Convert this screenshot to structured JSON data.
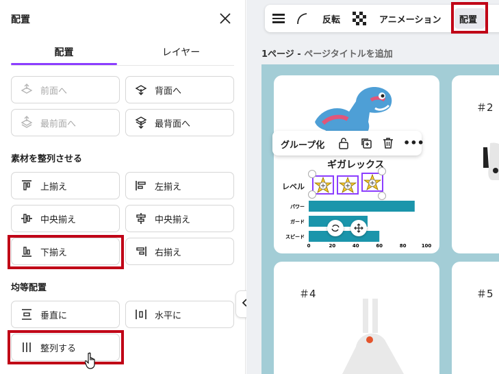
{
  "panel": {
    "title": "配置",
    "tabs": [
      "配置",
      "レイヤー"
    ],
    "order_buttons": [
      {
        "label": "前面へ",
        "icon": "bring-forward-icon",
        "disabled": true
      },
      {
        "label": "背面へ",
        "icon": "send-backward-icon",
        "disabled": false
      },
      {
        "label": "最前面へ",
        "icon": "bring-to-front-icon",
        "disabled": true
      },
      {
        "label": "最背面へ",
        "icon": "send-to-back-icon",
        "disabled": false
      }
    ],
    "align_section": "素材を整列させる",
    "align_buttons": [
      {
        "label": "上揃え",
        "icon": "align-top-icon"
      },
      {
        "label": "左揃え",
        "icon": "align-left-icon"
      },
      {
        "label": "中央揃え",
        "icon": "align-middle-icon"
      },
      {
        "label": "中央揃え",
        "icon": "align-center-icon"
      },
      {
        "label": "下揃え",
        "icon": "align-bottom-icon"
      },
      {
        "label": "右揃え",
        "icon": "align-right-icon"
      }
    ],
    "distribute_section": "均等配置",
    "distribute_buttons": [
      {
        "label": "垂直に",
        "icon": "distribute-vertical-icon"
      },
      {
        "label": "水平に",
        "icon": "distribute-horizontal-icon"
      },
      {
        "label": "整列する",
        "icon": "tidy-up-icon"
      }
    ]
  },
  "toolbar": {
    "flip": "反転",
    "animation": "アニメーション",
    "position": "配置"
  },
  "page": {
    "label_prefix": "1ページ - ",
    "label_title": "ページタイトルを追加"
  },
  "cards": {
    "c2": "＃2",
    "c4": "＃4",
    "c5": "＃5"
  },
  "context_menu": {
    "group": "グループ化"
  },
  "chart": {
    "title": "ギガレックス",
    "level_label": "レベル",
    "bars": [
      {
        "label": "パワー",
        "value": 90
      },
      {
        "label": "ガード",
        "value": 50
      },
      {
        "label": "スピード",
        "value": 60
      }
    ],
    "ticks": [
      "0",
      "20",
      "40",
      "60",
      "80",
      "100"
    ],
    "stars": 3,
    "bar_color": "#1b95ab"
  }
}
